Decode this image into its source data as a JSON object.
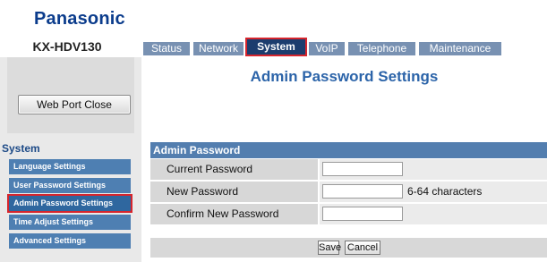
{
  "brand": {
    "logo": "Panasonic",
    "model": "KX-HDV130"
  },
  "tabs": [
    {
      "label": "Status"
    },
    {
      "label": "Network"
    },
    {
      "label": "System",
      "active": true
    },
    {
      "label": "VoIP"
    },
    {
      "label": "Telephone"
    },
    {
      "label": "Maintenance"
    }
  ],
  "sidebar": {
    "web_port_button": "Web Port Close",
    "section_title": "System",
    "items": [
      {
        "label": "Language Settings"
      },
      {
        "label": "User Password Settings"
      },
      {
        "label": "Admin Password Settings",
        "active": true
      },
      {
        "label": "Time Adjust Settings"
      },
      {
        "label": "Advanced Settings"
      }
    ]
  },
  "main": {
    "page_title": "Admin Password Settings",
    "section_header": "Admin Password",
    "fields": [
      {
        "label": "Current Password",
        "value": "",
        "hint": ""
      },
      {
        "label": "New Password",
        "value": "",
        "hint": "6-64 characters"
      },
      {
        "label": "Confirm New Password",
        "value": "",
        "hint": ""
      }
    ],
    "save_label": "Save",
    "cancel_label": "Cancel"
  },
  "colors": {
    "brand_blue": "#0b3c8c",
    "tab_inactive": "#7891b2",
    "tab_active": "#1c3d6e",
    "highlight_red": "#d6252d",
    "sidebar_item": "#4e7fb2",
    "section_header": "#537eaf",
    "title_blue": "#2c64a9"
  }
}
